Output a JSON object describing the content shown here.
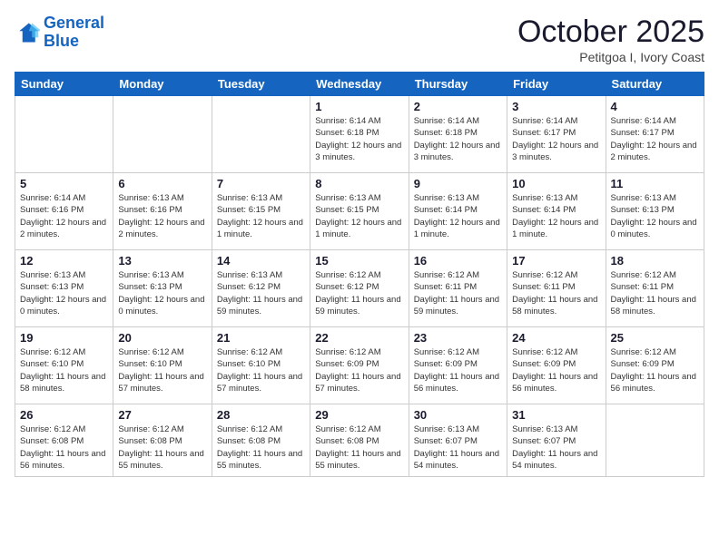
{
  "header": {
    "logo_line1": "General",
    "logo_line2": "Blue",
    "month": "October 2025",
    "location": "Petitgoa I, Ivory Coast"
  },
  "weekdays": [
    "Sunday",
    "Monday",
    "Tuesday",
    "Wednesday",
    "Thursday",
    "Friday",
    "Saturday"
  ],
  "weeks": [
    [
      {
        "day": "",
        "detail": ""
      },
      {
        "day": "",
        "detail": ""
      },
      {
        "day": "",
        "detail": ""
      },
      {
        "day": "1",
        "detail": "Sunrise: 6:14 AM\nSunset: 6:18 PM\nDaylight: 12 hours\nand 3 minutes."
      },
      {
        "day": "2",
        "detail": "Sunrise: 6:14 AM\nSunset: 6:18 PM\nDaylight: 12 hours\nand 3 minutes."
      },
      {
        "day": "3",
        "detail": "Sunrise: 6:14 AM\nSunset: 6:17 PM\nDaylight: 12 hours\nand 3 minutes."
      },
      {
        "day": "4",
        "detail": "Sunrise: 6:14 AM\nSunset: 6:17 PM\nDaylight: 12 hours\nand 2 minutes."
      }
    ],
    [
      {
        "day": "5",
        "detail": "Sunrise: 6:14 AM\nSunset: 6:16 PM\nDaylight: 12 hours\nand 2 minutes."
      },
      {
        "day": "6",
        "detail": "Sunrise: 6:13 AM\nSunset: 6:16 PM\nDaylight: 12 hours\nand 2 minutes."
      },
      {
        "day": "7",
        "detail": "Sunrise: 6:13 AM\nSunset: 6:15 PM\nDaylight: 12 hours\nand 1 minute."
      },
      {
        "day": "8",
        "detail": "Sunrise: 6:13 AM\nSunset: 6:15 PM\nDaylight: 12 hours\nand 1 minute."
      },
      {
        "day": "9",
        "detail": "Sunrise: 6:13 AM\nSunset: 6:14 PM\nDaylight: 12 hours\nand 1 minute."
      },
      {
        "day": "10",
        "detail": "Sunrise: 6:13 AM\nSunset: 6:14 PM\nDaylight: 12 hours\nand 1 minute."
      },
      {
        "day": "11",
        "detail": "Sunrise: 6:13 AM\nSunset: 6:13 PM\nDaylight: 12 hours\nand 0 minutes."
      }
    ],
    [
      {
        "day": "12",
        "detail": "Sunrise: 6:13 AM\nSunset: 6:13 PM\nDaylight: 12 hours\nand 0 minutes."
      },
      {
        "day": "13",
        "detail": "Sunrise: 6:13 AM\nSunset: 6:13 PM\nDaylight: 12 hours\nand 0 minutes."
      },
      {
        "day": "14",
        "detail": "Sunrise: 6:13 AM\nSunset: 6:12 PM\nDaylight: 11 hours\nand 59 minutes."
      },
      {
        "day": "15",
        "detail": "Sunrise: 6:12 AM\nSunset: 6:12 PM\nDaylight: 11 hours\nand 59 minutes."
      },
      {
        "day": "16",
        "detail": "Sunrise: 6:12 AM\nSunset: 6:11 PM\nDaylight: 11 hours\nand 59 minutes."
      },
      {
        "day": "17",
        "detail": "Sunrise: 6:12 AM\nSunset: 6:11 PM\nDaylight: 11 hours\nand 58 minutes."
      },
      {
        "day": "18",
        "detail": "Sunrise: 6:12 AM\nSunset: 6:11 PM\nDaylight: 11 hours\nand 58 minutes."
      }
    ],
    [
      {
        "day": "19",
        "detail": "Sunrise: 6:12 AM\nSunset: 6:10 PM\nDaylight: 11 hours\nand 58 minutes."
      },
      {
        "day": "20",
        "detail": "Sunrise: 6:12 AM\nSunset: 6:10 PM\nDaylight: 11 hours\nand 57 minutes."
      },
      {
        "day": "21",
        "detail": "Sunrise: 6:12 AM\nSunset: 6:10 PM\nDaylight: 11 hours\nand 57 minutes."
      },
      {
        "day": "22",
        "detail": "Sunrise: 6:12 AM\nSunset: 6:09 PM\nDaylight: 11 hours\nand 57 minutes."
      },
      {
        "day": "23",
        "detail": "Sunrise: 6:12 AM\nSunset: 6:09 PM\nDaylight: 11 hours\nand 56 minutes."
      },
      {
        "day": "24",
        "detail": "Sunrise: 6:12 AM\nSunset: 6:09 PM\nDaylight: 11 hours\nand 56 minutes."
      },
      {
        "day": "25",
        "detail": "Sunrise: 6:12 AM\nSunset: 6:09 PM\nDaylight: 11 hours\nand 56 minutes."
      }
    ],
    [
      {
        "day": "26",
        "detail": "Sunrise: 6:12 AM\nSunset: 6:08 PM\nDaylight: 11 hours\nand 56 minutes."
      },
      {
        "day": "27",
        "detail": "Sunrise: 6:12 AM\nSunset: 6:08 PM\nDaylight: 11 hours\nand 55 minutes."
      },
      {
        "day": "28",
        "detail": "Sunrise: 6:12 AM\nSunset: 6:08 PM\nDaylight: 11 hours\nand 55 minutes."
      },
      {
        "day": "29",
        "detail": "Sunrise: 6:12 AM\nSunset: 6:08 PM\nDaylight: 11 hours\nand 55 minutes."
      },
      {
        "day": "30",
        "detail": "Sunrise: 6:13 AM\nSunset: 6:07 PM\nDaylight: 11 hours\nand 54 minutes."
      },
      {
        "day": "31",
        "detail": "Sunrise: 6:13 AM\nSunset: 6:07 PM\nDaylight: 11 hours\nand 54 minutes."
      },
      {
        "day": "",
        "detail": ""
      }
    ]
  ]
}
